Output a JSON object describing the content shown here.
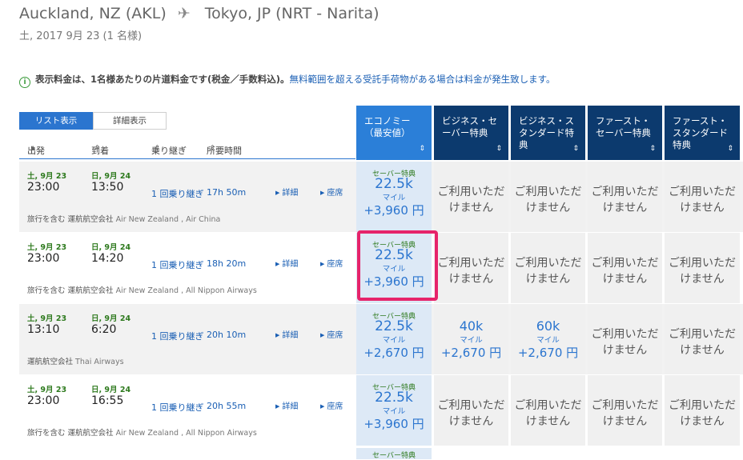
{
  "header": {
    "origin": "Auckland, NZ (AKL)",
    "plane_icon": "plane-icon",
    "destination": "Tokyo, JP (NRT - Narita)",
    "date_line": "土, 2017 9月 23 (1 名様)"
  },
  "notice": {
    "bold_text": "表示料金は、1名様あたりの片道料金です(税金／手数料込)。",
    "link_text": "無料範囲を超える受託手荷物がある場合は料金が発生致します。"
  },
  "view_toggle": {
    "list": "リスト表示",
    "detail": "詳細表示"
  },
  "sort_headers": {
    "departure": "出発",
    "arrival": "到着",
    "connections": "乗り継ぎ",
    "duration": "所要時間"
  },
  "fare_columns": [
    {
      "label": "エコノミー（最安値）"
    },
    {
      "label": "ビジネス・セーバー特典"
    },
    {
      "label": "ビジネス・スタンダード特典"
    },
    {
      "label": "ファースト・セーバー特典"
    },
    {
      "label": "ファースト・スタンダード特典"
    }
  ],
  "rows": [
    {
      "dep_date": "土, 9月 23",
      "dep_time": "23:00",
      "arr_date": "日, 9月 24",
      "arr_time": "13:50",
      "stops": "1 回乗り継ぎ",
      "duration": "17h 50m",
      "detail_link": "詳細",
      "seat_link": "座席",
      "carriers_label": "旅行を含む 運航航空会社",
      "carriers": "Air New Zealand , Air China",
      "fares": [
        {
          "badge": "セーバー特典",
          "miles": "22.5k",
          "unit": "マイル",
          "price": "+3,960 円"
        },
        {
          "na": "ご利用いただけません"
        },
        {
          "na": "ご利用いただけません"
        },
        {
          "na": "ご利用いただけません"
        },
        {
          "na": "ご利用いただけません"
        }
      ]
    },
    {
      "dep_date": "土, 9月 23",
      "dep_time": "23:00",
      "arr_date": "日, 9月 24",
      "arr_time": "14:20",
      "stops": "1 回乗り継ぎ",
      "duration": "18h 20m",
      "detail_link": "詳細",
      "seat_link": "座席",
      "carriers_label": "旅行を含む 運航航空会社",
      "carriers": "Air New Zealand , All Nippon Airways",
      "fares": [
        {
          "badge": "セーバー特典",
          "miles": "22.5k",
          "unit": "マイル",
          "price": "+3,960 円"
        },
        {
          "na": "ご利用いただけません"
        },
        {
          "na": "ご利用いただけません"
        },
        {
          "na": "ご利用いただけません"
        },
        {
          "na": "ご利用いただけません"
        }
      ]
    },
    {
      "dep_date": "土, 9月 23",
      "dep_time": "13:10",
      "arr_date": "日, 9月 24",
      "arr_time": "6:20",
      "stops": "1 回乗り継ぎ",
      "duration": "20h 10m",
      "detail_link": "詳細",
      "seat_link": "座席",
      "carriers_label": "運航航空会社",
      "carriers": "Thai Airways",
      "fares": [
        {
          "badge": "セーバー特典",
          "miles": "22.5k",
          "unit": "マイル",
          "price": "+2,670 円"
        },
        {
          "miles": "40k",
          "unit": "マイル",
          "price": "+2,670 円"
        },
        {
          "miles": "60k",
          "unit": "マイル",
          "price": "+2,670 円"
        },
        {
          "na": "ご利用いただけません"
        },
        {
          "na": "ご利用いただけません"
        }
      ]
    },
    {
      "dep_date": "土, 9月 23",
      "dep_time": "23:00",
      "arr_date": "日, 9月 24",
      "arr_time": "16:55",
      "stops": "1 回乗り継ぎ",
      "duration": "20h 55m",
      "detail_link": "詳細",
      "seat_link": "座席",
      "carriers_label": "旅行を含む 運航航空会社",
      "carriers": "Air New Zealand , All Nippon Airways",
      "fares": [
        {
          "badge": "セーバー特典",
          "miles": "22.5k",
          "unit": "マイル",
          "price": "+3,960 円"
        },
        {
          "na": "ご利用いただけません"
        },
        {
          "na": "ご利用いただけません"
        },
        {
          "na": "ご利用いただけません"
        },
        {
          "na": "ご利用いただけません"
        }
      ]
    }
  ],
  "partial_row_badge": "セーバー特典",
  "colors": {
    "accent": "#2b75cf",
    "header_dark": "#0c3a6e",
    "highlight": "#e6246b",
    "green": "#2e7a1e"
  }
}
